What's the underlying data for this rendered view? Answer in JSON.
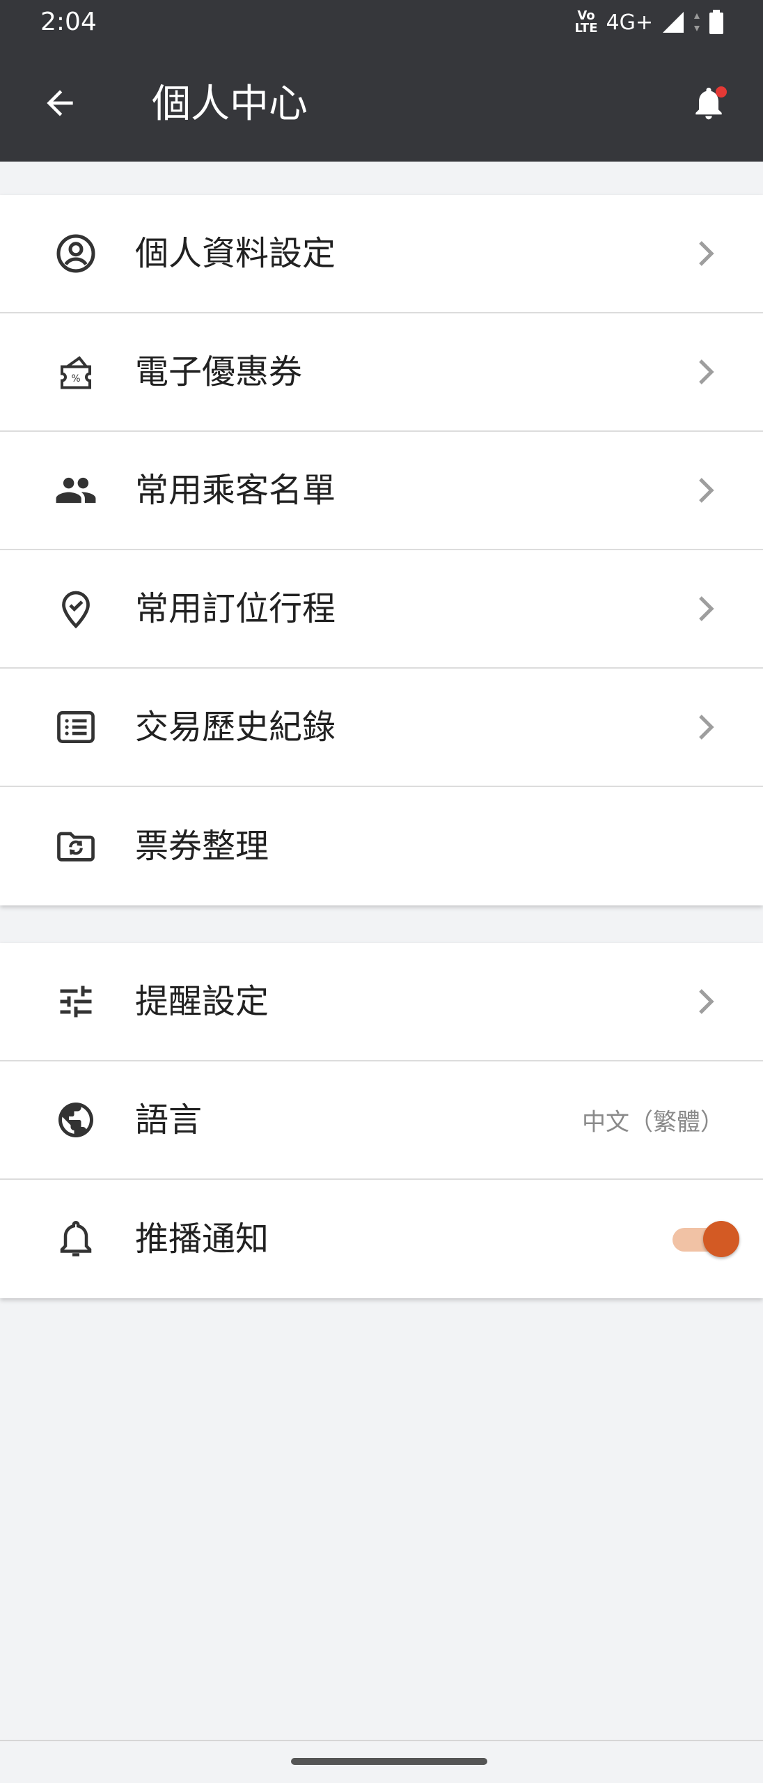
{
  "status_bar": {
    "time": "2:04",
    "volte_top": "Vo",
    "volte_bottom": "LTE",
    "network": "4G+"
  },
  "header": {
    "title": "個人中心",
    "notification_dot_color": "#e53935"
  },
  "menu_primary": [
    {
      "label": "個人資料設定",
      "icon": "account-circle-icon",
      "chevron": true
    },
    {
      "label": "電子優惠券",
      "icon": "coupon-icon",
      "chevron": true
    },
    {
      "label": "常用乘客名單",
      "icon": "people-icon",
      "chevron": true
    },
    {
      "label": "常用訂位行程",
      "icon": "location-check-icon",
      "chevron": true
    },
    {
      "label": "交易歷史紀錄",
      "icon": "list-icon",
      "chevron": true
    },
    {
      "label": "票券整理",
      "icon": "folder-sync-icon",
      "chevron": false
    }
  ],
  "menu_settings": {
    "reminder": {
      "label": "提醒設定",
      "icon": "sliders-icon"
    },
    "language": {
      "label": "語言",
      "icon": "globe-icon",
      "value": "中文（繁體）"
    },
    "push": {
      "label": "推播通知",
      "icon": "bell-icon",
      "enabled": true
    }
  },
  "colors": {
    "header_bg": "#36373b",
    "accent": "#d35a24",
    "page_bg": "#f2f3f5"
  }
}
